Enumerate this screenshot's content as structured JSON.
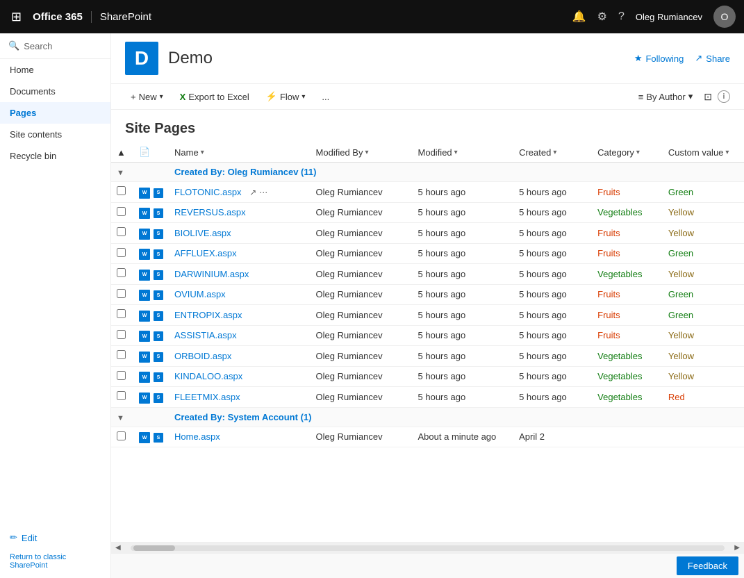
{
  "topnav": {
    "office_label": "Office 365",
    "app_label": "SharePoint",
    "user_name": "Oleg Rumiancev",
    "user_initial": "O"
  },
  "sidebar": {
    "search_placeholder": "Search",
    "items": [
      {
        "id": "home",
        "label": "Home",
        "active": false
      },
      {
        "id": "documents",
        "label": "Documents",
        "active": false
      },
      {
        "id": "pages",
        "label": "Pages",
        "active": true
      },
      {
        "id": "site-contents",
        "label": "Site contents",
        "active": false
      },
      {
        "id": "recycle-bin",
        "label": "Recycle bin",
        "active": false
      }
    ],
    "edit_label": "Edit",
    "return_label": "Return to classic SharePoint"
  },
  "site_header": {
    "icon_letter": "D",
    "site_title": "Demo",
    "following_label": "Following",
    "share_label": "Share"
  },
  "toolbar": {
    "new_label": "New",
    "export_label": "Export to Excel",
    "flow_label": "Flow",
    "more_label": "...",
    "by_author_label": "By Author",
    "filter_label": "Filter",
    "info_label": "Info"
  },
  "list": {
    "title": "Site Pages",
    "columns": [
      {
        "id": "name",
        "label": "Name",
        "sortable": true
      },
      {
        "id": "modified_by",
        "label": "Modified By",
        "sortable": true
      },
      {
        "id": "modified",
        "label": "Modified",
        "sortable": true
      },
      {
        "id": "created",
        "label": "Created",
        "sortable": true
      },
      {
        "id": "category",
        "label": "Category",
        "sortable": true
      },
      {
        "id": "custom_value",
        "label": "Custom value",
        "sortable": true
      }
    ],
    "groups": [
      {
        "label": "Created By: Oleg Rumiancev (11)",
        "count": 11,
        "rows": [
          {
            "name": "FLOTONIC.aspx",
            "modified_by": "Oleg Rumiancev",
            "modified": "5 hours ago",
            "created": "5 hours ago",
            "category": "Fruits",
            "custom_value": "Green"
          },
          {
            "name": "REVERSUS.aspx",
            "modified_by": "Oleg Rumiancev",
            "modified": "5 hours ago",
            "created": "5 hours ago",
            "category": "Vegetables",
            "custom_value": "Yellow"
          },
          {
            "name": "BIOLIVE.aspx",
            "modified_by": "Oleg Rumiancev",
            "modified": "5 hours ago",
            "created": "5 hours ago",
            "category": "Fruits",
            "custom_value": "Yellow"
          },
          {
            "name": "AFFLUEX.aspx",
            "modified_by": "Oleg Rumiancev",
            "modified": "5 hours ago",
            "created": "5 hours ago",
            "category": "Fruits",
            "custom_value": "Green"
          },
          {
            "name": "DARWINIUM.aspx",
            "modified_by": "Oleg Rumiancev",
            "modified": "5 hours ago",
            "created": "5 hours ago",
            "category": "Vegetables",
            "custom_value": "Yellow"
          },
          {
            "name": "OVIUM.aspx",
            "modified_by": "Oleg Rumiancev",
            "modified": "5 hours ago",
            "created": "5 hours ago",
            "category": "Fruits",
            "custom_value": "Green"
          },
          {
            "name": "ENTROPIX.aspx",
            "modified_by": "Oleg Rumiancev",
            "modified": "5 hours ago",
            "created": "5 hours ago",
            "category": "Fruits",
            "custom_value": "Green"
          },
          {
            "name": "ASSISTIA.aspx",
            "modified_by": "Oleg Rumiancev",
            "modified": "5 hours ago",
            "created": "5 hours ago",
            "category": "Fruits",
            "custom_value": "Yellow"
          },
          {
            "name": "ORBOID.aspx",
            "modified_by": "Oleg Rumiancev",
            "modified": "5 hours ago",
            "created": "5 hours ago",
            "category": "Vegetables",
            "custom_value": "Yellow"
          },
          {
            "name": "KINDALOO.aspx",
            "modified_by": "Oleg Rumiancev",
            "modified": "5 hours ago",
            "created": "5 hours ago",
            "category": "Vegetables",
            "custom_value": "Yellow"
          },
          {
            "name": "FLEETMIX.aspx",
            "modified_by": "Oleg Rumiancev",
            "modified": "5 hours ago",
            "created": "5 hours ago",
            "category": "Vegetables",
            "custom_value": "Red"
          }
        ]
      },
      {
        "label": "Created By: System Account (1)",
        "count": 1,
        "rows": [
          {
            "name": "Home.aspx",
            "modified_by": "Oleg Rumiancev",
            "modified": "About a minute ago",
            "created": "April 2",
            "category": "",
            "custom_value": ""
          }
        ]
      }
    ]
  },
  "bottom": {
    "feedback_label": "Feedback"
  }
}
